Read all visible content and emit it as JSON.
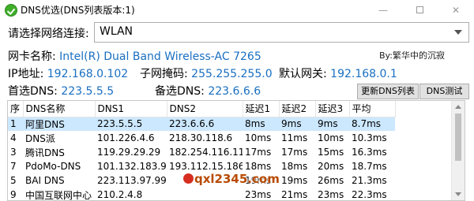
{
  "window": {
    "title": "DNS优选(DNS列表版本:1)"
  },
  "connection": {
    "label": "请选择网络连接:",
    "selected": "WLAN"
  },
  "adapter": {
    "label": "网卡名称:",
    "value": "Intel(R) Dual Band Wireless-AC 7265"
  },
  "author": "By:繁华中的沉寂",
  "ip": {
    "label": "IP地址:",
    "value": "192.168.0.102"
  },
  "mask": {
    "label": "子网掩码:",
    "value": "255.255.255.0"
  },
  "gateway": {
    "label": "默认网关:",
    "value": "192.168.0.1"
  },
  "primary_dns": {
    "label": "首选DNS:",
    "value": "223.5.5.5"
  },
  "secondary_dns": {
    "label": "备选DNS:",
    "value": "223.6.6.6"
  },
  "buttons": {
    "update": "更新DNS列表",
    "test": "DNS测试"
  },
  "table": {
    "headers": [
      "序",
      "DNS名称",
      "DNS1",
      "DNS2",
      "延迟1",
      "延迟2",
      "延迟3",
      "平均"
    ],
    "rows": [
      [
        "1",
        "阿里DNS",
        "223.5.5.5",
        "223.6.6.6",
        "8ms",
        "9ms",
        "9ms",
        "8.7ms"
      ],
      [
        "4",
        "DNS派",
        "101.226.4.6",
        "218.30.118.6",
        "10ms",
        "11ms",
        "10ms",
        "10.3ms"
      ],
      [
        "3",
        "腾讯DNS",
        "119.29.29.29",
        "182.254.116.116",
        "17ms",
        "17ms",
        "15ms",
        "16.3ms"
      ],
      [
        "7",
        "PdoMo-DNS",
        "101.132.183.99",
        "193.112.15.186",
        "18ms",
        "18ms",
        "20ms",
        "18.7ms"
      ],
      [
        "5",
        "BAI DNS",
        "223.113.97.99",
        "",
        "19ms",
        "19ms",
        "26ms",
        "21.3ms"
      ],
      [
        "9",
        "中国互联网中心",
        "210.2.4.8",
        "",
        "23ms",
        "21ms",
        "23ms",
        "22.3ms"
      ]
    ]
  },
  "watermark": "qxl2345.com",
  "colors": {
    "value_blue": "#1a6fc1",
    "selection": "#cce8ff"
  }
}
